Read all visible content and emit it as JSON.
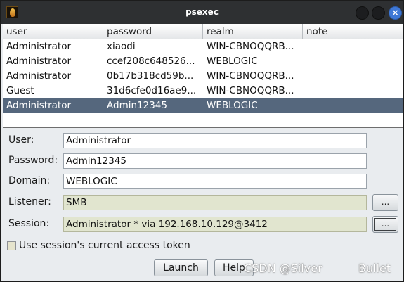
{
  "window": {
    "title": "psexec",
    "close_glyph": "×"
  },
  "icons": {
    "app": "flame-app-icon"
  },
  "table": {
    "columns": [
      "user",
      "password",
      "realm",
      "note"
    ],
    "rows": [
      [
        "Administrator",
        "xiaodi",
        "WIN-CBNOQQRB...",
        ""
      ],
      [
        "Administrator",
        "ccef208c648526...",
        "WEBLOGIC",
        ""
      ],
      [
        "Administrator",
        "0b17b318cd59b...",
        "WIN-CBNOQQRB...",
        ""
      ],
      [
        "Guest",
        "31d6cfe0d16ae9...",
        "WIN-CBNOQQRB...",
        ""
      ],
      [
        "Administrator",
        "Admin12345",
        "WEBLOGIC",
        ""
      ]
    ],
    "selected_row": 5
  },
  "form": {
    "user_label": "User:",
    "user_value": "Administrator",
    "password_label": "Password:",
    "password_value": "Admin12345",
    "domain_label": "Domain:",
    "domain_value": "WEBLOGIC",
    "listener_label": "Listener:",
    "listener_value": "SMB",
    "session_label": "Session:",
    "session_value": "Administrator * via  192.168.10.129@3412",
    "browse_label": "...",
    "token_checkbox_label": "Use session's current access token",
    "token_checked": false
  },
  "buttons": {
    "launch": "Launch",
    "help": "Help"
  },
  "watermark": {
    "left": "CSDN @Silver",
    "right": "Bullet"
  }
}
